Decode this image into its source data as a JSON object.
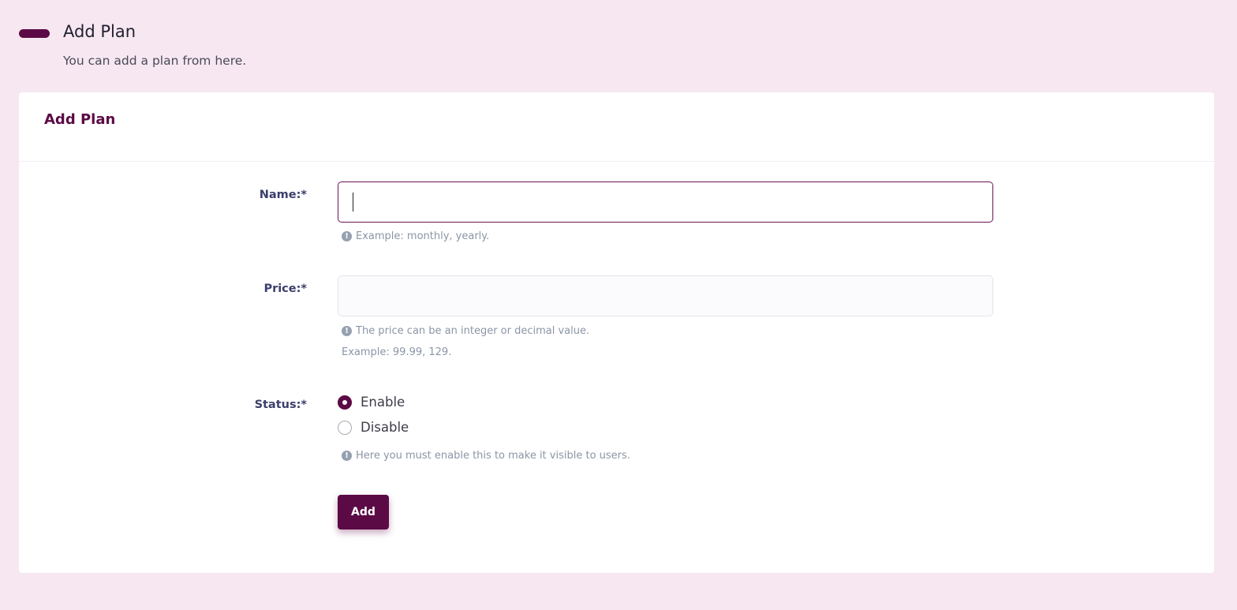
{
  "header": {
    "title": "Add Plan",
    "subtitle": "You can add a plan from here."
  },
  "card": {
    "title": "Add Plan"
  },
  "form": {
    "name": {
      "label": "Name:*",
      "value": "",
      "hint": "Example: monthly, yearly."
    },
    "price": {
      "label": "Price:*",
      "value": "",
      "hint_line1": "The price can be an integer or decimal value.",
      "hint_line2": "Example: 99.99, 129."
    },
    "status": {
      "label": "Status:*",
      "options": [
        "Enable",
        "Disable"
      ],
      "selected": "Enable",
      "hint": "Here you must enable this to make it visible to users."
    },
    "submit_label": "Add"
  },
  "icons": {
    "hint": "exclamation-circle-icon"
  },
  "colors": {
    "accent": "#5c0a45",
    "background": "#f6e7f1",
    "hint": "#8b95a6"
  }
}
